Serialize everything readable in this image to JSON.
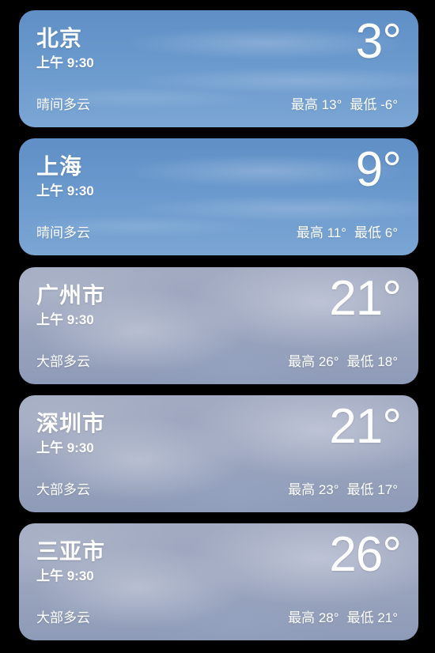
{
  "cities": [
    {
      "name": "北京",
      "time": "上午 9:30",
      "temp": "3°",
      "condition": "晴间多云",
      "high": "最高 13°",
      "low": "最低 -6°"
    },
    {
      "name": "上海",
      "time": "上午 9:30",
      "temp": "9°",
      "condition": "晴间多云",
      "high": "最高 11°",
      "low": "最低 6°"
    },
    {
      "name": "广州市",
      "time": "上午 9:30",
      "temp": "21°",
      "condition": "大部多云",
      "high": "最高 26°",
      "low": "最低 18°"
    },
    {
      "name": "深圳市",
      "time": "上午 9:30",
      "temp": "21°",
      "condition": "大部多云",
      "high": "最高 23°",
      "low": "最低 17°"
    },
    {
      "name": "三亚市",
      "time": "上午 9:30",
      "temp": "26°",
      "condition": "大部多云",
      "high": "最高 28°",
      "low": "最低 21°"
    }
  ]
}
